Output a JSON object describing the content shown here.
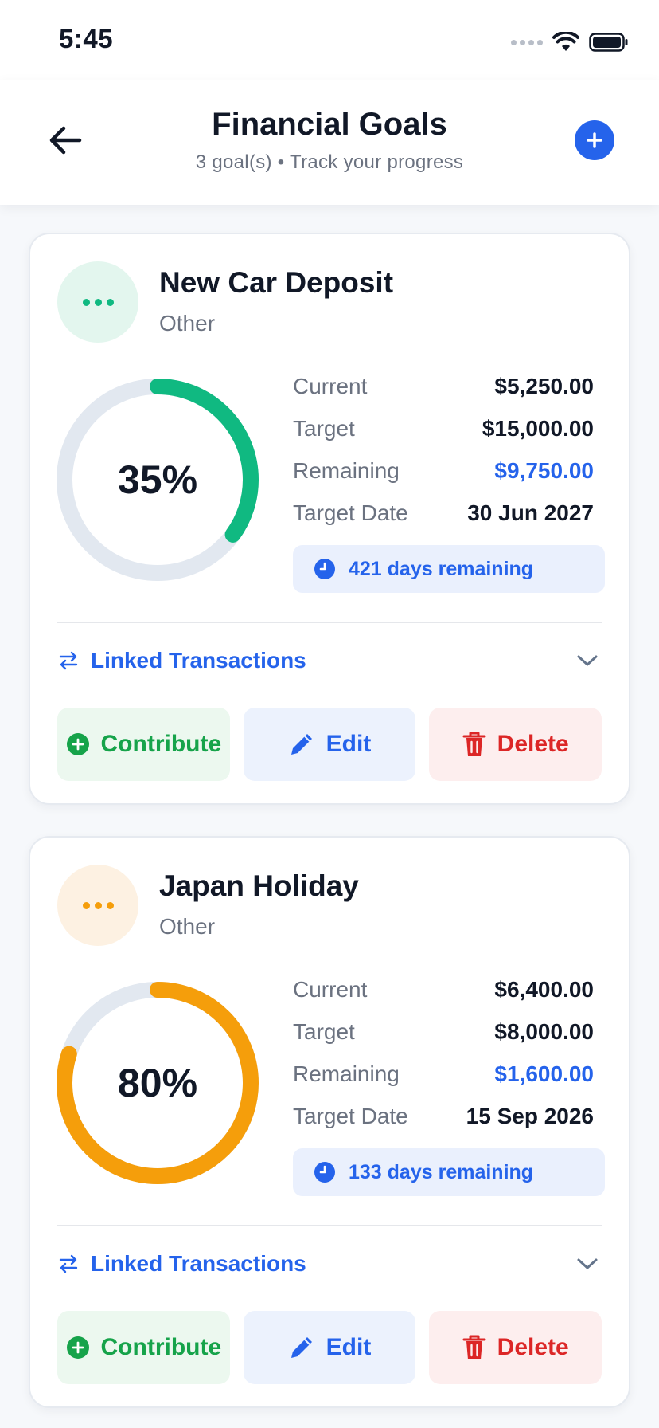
{
  "status_bar": {
    "time": "5:45"
  },
  "header": {
    "title": "Financial Goals",
    "subtitle": "3 goal(s) • Track your progress"
  },
  "goals": [
    {
      "name": "New Car Deposit",
      "category": "Other",
      "percent": 35,
      "percent_label": "35%",
      "accent_color": "#10b981",
      "avatar_bg": "#e3f6ee",
      "current_label": "Current",
      "current": "$5,250.00",
      "target_label": "Target",
      "target": "$15,000.00",
      "remaining_label": "Remaining",
      "remaining": "$9,750.00",
      "target_date_label": "Target Date",
      "target_date": "30 Jun 2027",
      "days_remaining": "421 days remaining",
      "linked_label": "Linked Transactions",
      "contribute_label": "Contribute",
      "edit_label": "Edit",
      "delete_label": "Delete"
    },
    {
      "name": "Japan Holiday",
      "category": "Other",
      "percent": 80,
      "percent_label": "80%",
      "accent_color": "#f59e0b",
      "avatar_bg": "#fdf1e2",
      "current_label": "Current",
      "current": "$6,400.00",
      "target_label": "Target",
      "target": "$8,000.00",
      "remaining_label": "Remaining",
      "remaining": "$1,600.00",
      "target_date_label": "Target Date",
      "target_date": "15 Sep 2026",
      "days_remaining": "133 days remaining",
      "linked_label": "Linked Transactions",
      "contribute_label": "Contribute",
      "edit_label": "Edit",
      "delete_label": "Delete"
    }
  ],
  "colors": {
    "primary": "#2563eb",
    "success": "#16a34a",
    "danger": "#dc2626",
    "ring_track": "#e2e8f0"
  }
}
